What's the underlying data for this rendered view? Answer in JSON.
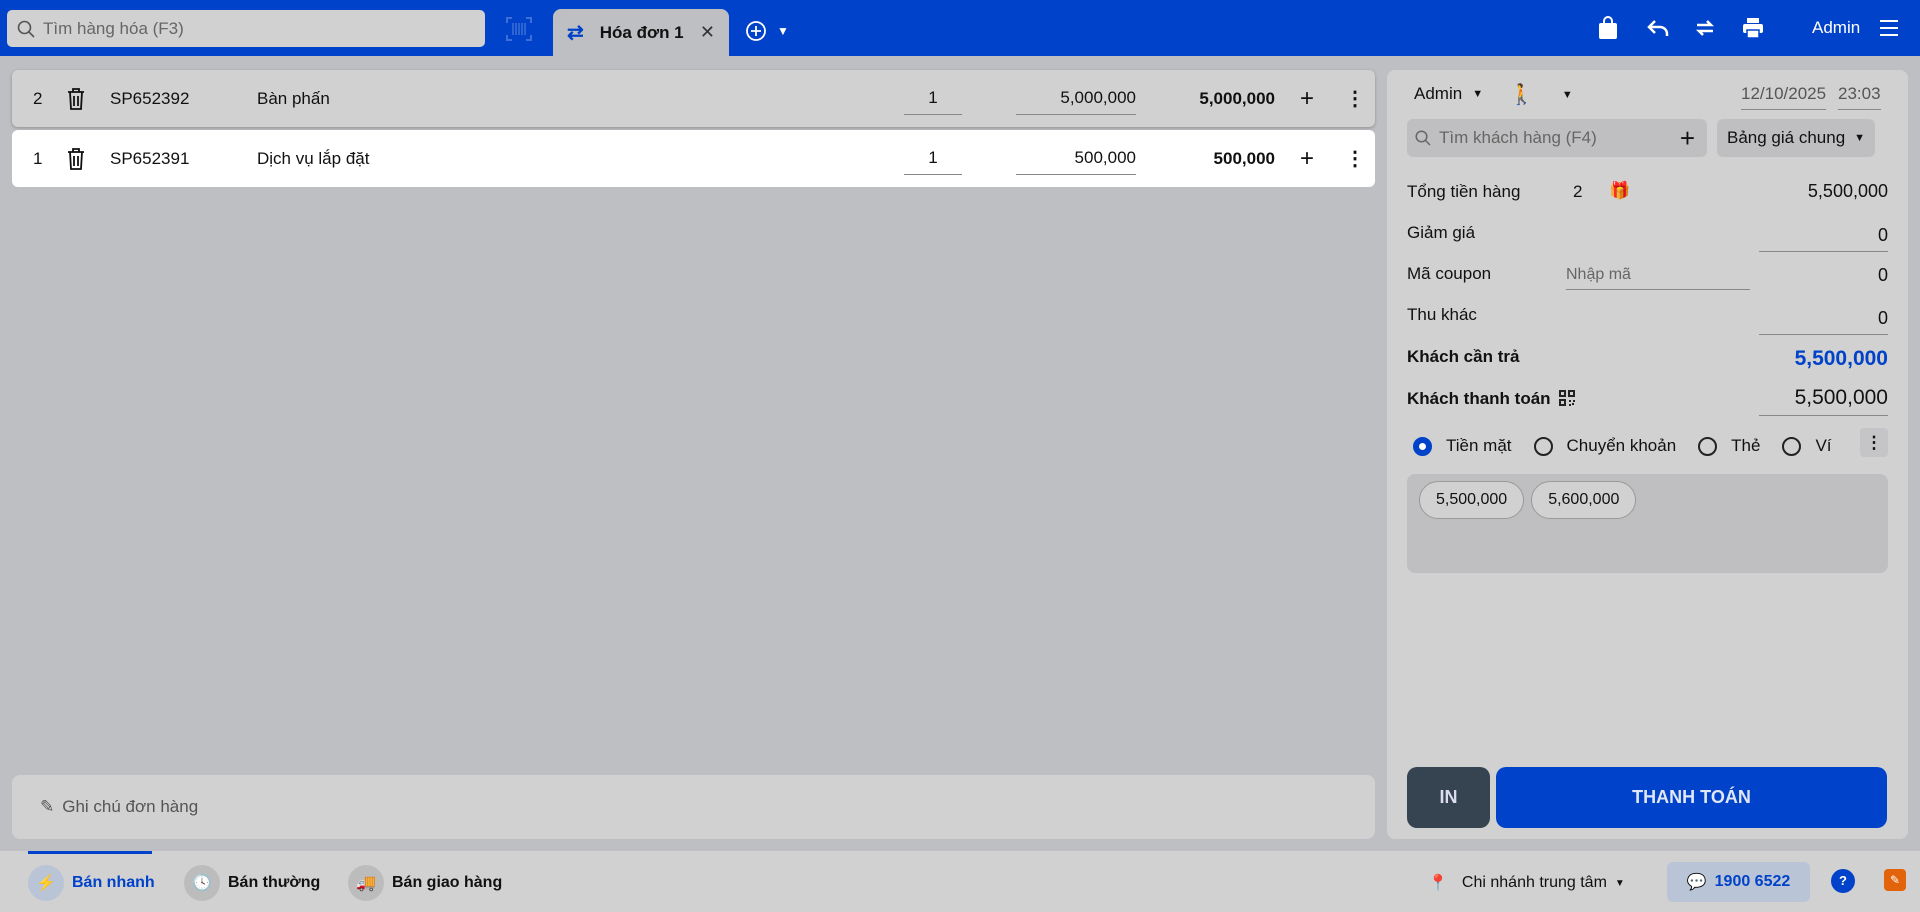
{
  "topbar": {
    "search_placeholder": "Tìm hàng hóa (F3)",
    "tab_label": "Hóa đơn 1",
    "user": "Admin"
  },
  "items": [
    {
      "index": "2",
      "code": "SP652392",
      "name": "Bàn phấn",
      "qty": "1",
      "price": "5,000,000",
      "total": "5,000,000"
    },
    {
      "index": "1",
      "code": "SP652391",
      "name": "Dịch vụ lắp đặt",
      "qty": "1",
      "price": "500,000",
      "total": "500,000"
    }
  ],
  "notes_placeholder": "Ghi chú đơn hàng",
  "panel": {
    "seller": "Admin",
    "date": "12/10/2025",
    "time": "23:03",
    "customer_placeholder": "Tìm khách hàng (F4)",
    "price_list": "Bảng giá chung",
    "subtotal_label": "Tổng tiền hàng",
    "item_count": "2",
    "subtotal": "5,500,000",
    "discount_label": "Giảm giá",
    "discount": "0",
    "coupon_label": "Mã coupon",
    "coupon_placeholder": "Nhập mã",
    "coupon_value": "0",
    "other_label": "Thu khác",
    "other": "0",
    "due_label": "Khách cần trả",
    "due": "5,500,000",
    "paid_label": "Khách thanh toán",
    "paid": "5,500,000",
    "methods": [
      "Tiền mặt",
      "Chuyển khoản",
      "Thẻ",
      "Ví"
    ],
    "suggestions": [
      "5,500,000",
      "5,600,000"
    ],
    "print_label": "IN",
    "pay_label": "THANH TOÁN"
  },
  "bottom": {
    "modes": [
      "Bán nhanh",
      "Bán thường",
      "Bán giao hàng"
    ],
    "branch": "Chi nhánh trung tâm",
    "hotline": "1900 6522"
  },
  "colors": {
    "brand": "#0042c9",
    "due": "#0042c9",
    "gift": "#e0115f"
  }
}
